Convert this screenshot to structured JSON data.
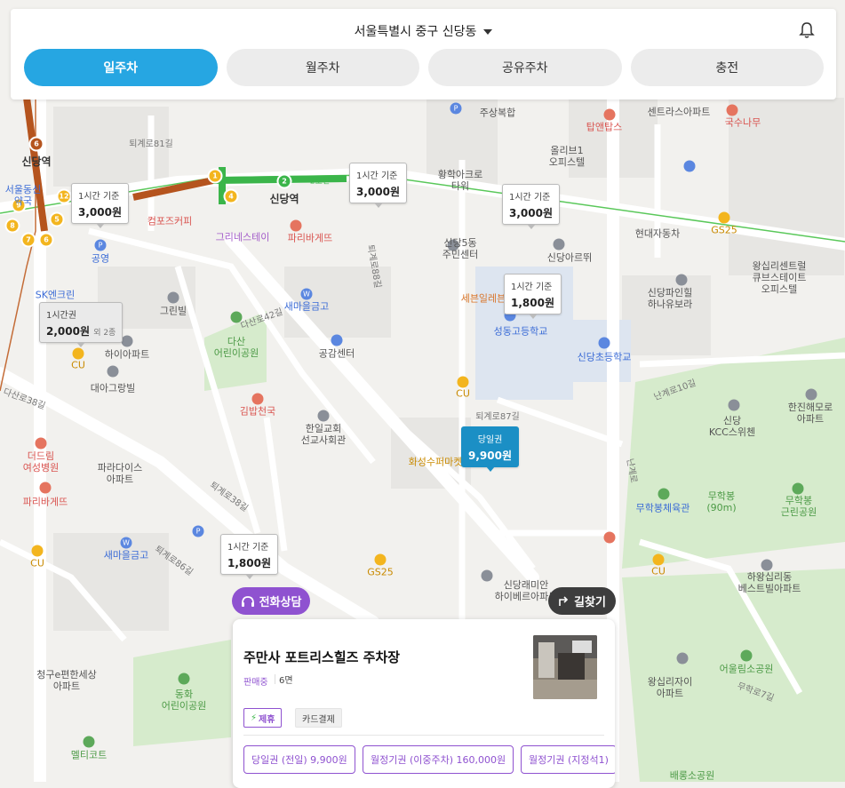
{
  "header": {
    "location": "서울특별시 중구 신당동",
    "tabs": [
      {
        "label": "일주차",
        "active": true
      },
      {
        "label": "월주차",
        "active": false
      },
      {
        "label": "공유주차",
        "active": false
      },
      {
        "label": "충전",
        "active": false
      }
    ]
  },
  "map": {
    "price_markers": [
      {
        "line1": "1시간 기준",
        "line2": "3,000원",
        "kind": "normal"
      },
      {
        "line1": "1시간 기준",
        "line2": "3,000원",
        "kind": "normal"
      },
      {
        "line1": "1시간 기준",
        "line2": "3,000원",
        "kind": "normal"
      },
      {
        "line1": "1시간 기준",
        "line2": "1,800원",
        "kind": "normal"
      },
      {
        "line1": "1시간권",
        "line2": "2,000원",
        "extra": "외 2종",
        "kind": "gray"
      },
      {
        "line1": "당일권",
        "line2": "9,900원",
        "kind": "selected"
      },
      {
        "line1": "1시간 기준",
        "line2": "1,800원",
        "kind": "normal"
      }
    ],
    "labels": {
      "sindang_stn": "신당역",
      "sindang_stn2": "신당역",
      "line2": "2호선",
      "compose": "컴포즈커피",
      "paris1": "파리바게뜨",
      "greenestay": "그리네스테이",
      "gong": "공영",
      "skenclean": "SK엔크린",
      "grinvil": "그린빌",
      "saemaeul": "새마을금고",
      "gonggam": "공감센터",
      "dasan": "다산\n어린이공원",
      "hanil": "한일교회\n선교사회관",
      "kimbap": "김밥천국",
      "haia": "하이아파트",
      "daea": "대아그랑빌",
      "deodeum": "더드림\n여성병원",
      "paradise": "파라다이스\n아파트",
      "paris2": "파리바게뜨",
      "saemaeul2": "새마을금고",
      "cu1": "CU",
      "cu2": "CU",
      "cu3": "CU",
      "cu4": "CU",
      "gs1": "GS25",
      "gs2": "GS25",
      "hwangak": "황학아크로\n타워",
      "sindang5": "신당5동\n주민센터",
      "sebon": "세븐일레븐",
      "seongdong_hs": "성동고등학교",
      "sindang_el": "신당초등학교",
      "hwasung": "화성수퍼마켓",
      "sindang_arum": "신당아르뛰",
      "olleeb": "올리브1\n오피스텔",
      "hyundai": "현대자동차",
      "gs3": "GS25",
      "wangsip": "왕십리센트럴\n큐브스테이트\n오피스텔",
      "sindang_pairon": "신당파인힐\n하나유보라",
      "hanjin": "한진해모로\n아파트",
      "kcc": "신당\nKCC스위첸",
      "muhakbong": "무학봉\n(90m)",
      "muhakbong_park": "무학봉\n근린공원",
      "muhak_stop": "무학봉체육관",
      "hawang": "하왕십리동\n베스트빌아파트",
      "wangsip_ja": "왕십리자이\n아파트",
      "eodeul": "어울림소공원",
      "baeknyong": "배롱소공원",
      "sindang_rem": "신당래미안\n하이베르아파트",
      "cheonggu": "청구e편한세상\n아파트",
      "donghwa": "동화\n어린이공원",
      "melticot": "멜티코트",
      "tap": "탑앤탑스",
      "juisan": "주상복합",
      "gukasu": "국수나무",
      "central": "센트라스아파트",
      "seoulmyeon": "서울동신\n약국",
      "street1": "퇴계로81길",
      "street2": "퇴계로87길",
      "street3": "퇴계로88길",
      "street4": "다산로42길",
      "street5": "다산로38길",
      "street6": "퇴계로86길",
      "street7": "퇴계로38길",
      "street8": "난계로",
      "street9": "무학로7길",
      "street10": "난계로10길"
    }
  },
  "buttons": {
    "phone": "전화상담",
    "route": "길찾기"
  },
  "card": {
    "title": "주만사 포트리스힐즈 주차장",
    "status": "판매중",
    "spaces": "6면",
    "badges": [
      "제휴",
      "카드결제"
    ],
    "tickets": [
      "당일권 (전일) 9,900원",
      "월정기권 (이중주차) 160,000원",
      "월정기권 (지정석1)"
    ]
  },
  "colors": {
    "accent": "#26a6e2",
    "purple": "#8f52d0",
    "selected_marker": "#1b8fc5",
    "line6": "#b5541e",
    "line2": "#3bb54a"
  }
}
